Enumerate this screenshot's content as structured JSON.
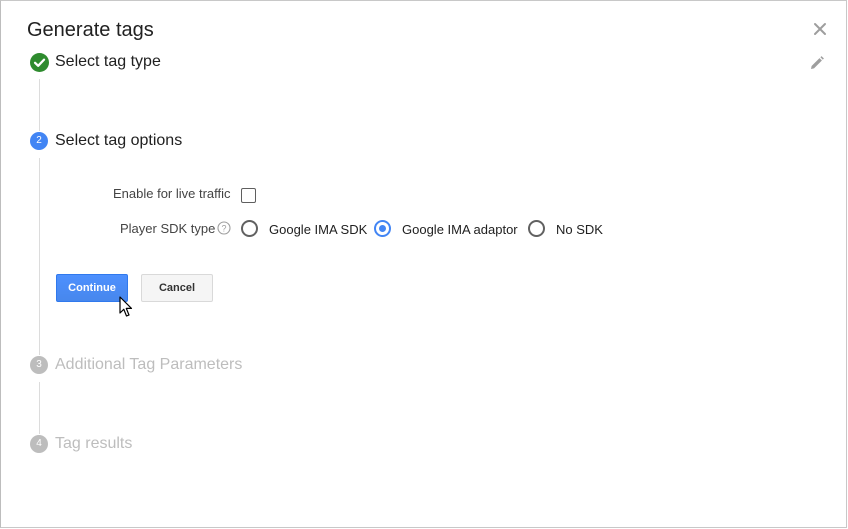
{
  "dialog": {
    "title": "Generate tags",
    "close_icon": "close-icon",
    "edit_icon": "pencil-icon"
  },
  "steps": [
    {
      "number": "",
      "label": "Select tag type",
      "state": "completed",
      "icon": "check-icon"
    },
    {
      "number": "2",
      "label": "Select tag options",
      "state": "active"
    },
    {
      "number": "3",
      "label": "Additional Tag Parameters",
      "state": "inactive"
    },
    {
      "number": "4",
      "label": "Tag results",
      "state": "inactive"
    }
  ],
  "form": {
    "live_traffic_label": "Enable for live traffic",
    "live_traffic_checked": false,
    "sdk_type_label": "Player SDK type",
    "help_icon": "help-icon",
    "sdk_options": [
      {
        "label": "Google IMA SDK",
        "selected": false
      },
      {
        "label": "Google IMA adaptor",
        "selected": true
      },
      {
        "label": "No SDK",
        "selected": false
      }
    ]
  },
  "buttons": {
    "continue_label": "Continue",
    "cancel_label": "Cancel"
  },
  "colors": {
    "accent": "#4285f4",
    "completed": "#2e8b2e",
    "inactive_circle": "#bdbdbd",
    "inactive_text": "#bdbdbd",
    "primary_button": "#4d90fe"
  }
}
